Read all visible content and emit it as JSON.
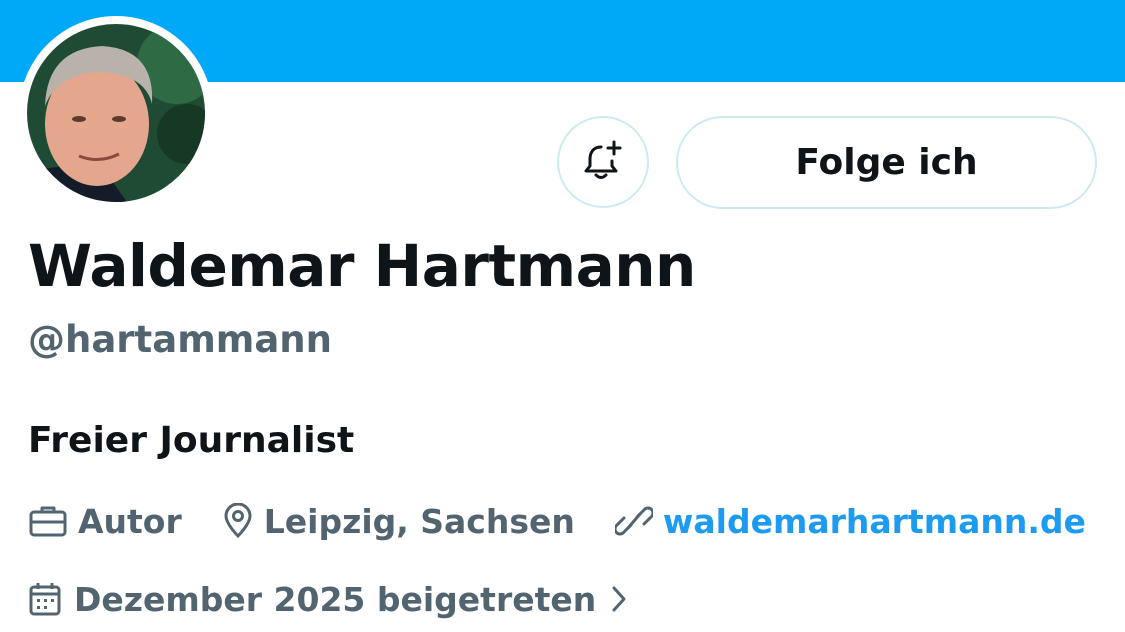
{
  "profile": {
    "display_name": "Waldemar Hartmann",
    "handle": "@hartammann",
    "bio": "Freier Journalist",
    "occupation": "Autor",
    "location": "Leipzig, Sachsen",
    "website": "waldemarhartmann.de",
    "joined": "Dezember 2025 beigetreten"
  },
  "actions": {
    "follow_label": "Folge ich",
    "notify_icon": "bell-plus-icon"
  },
  "colors": {
    "banner": "#00a8f8",
    "link": "#1d9bf0",
    "secondary_text": "#536471",
    "primary_text": "#0f1419"
  }
}
